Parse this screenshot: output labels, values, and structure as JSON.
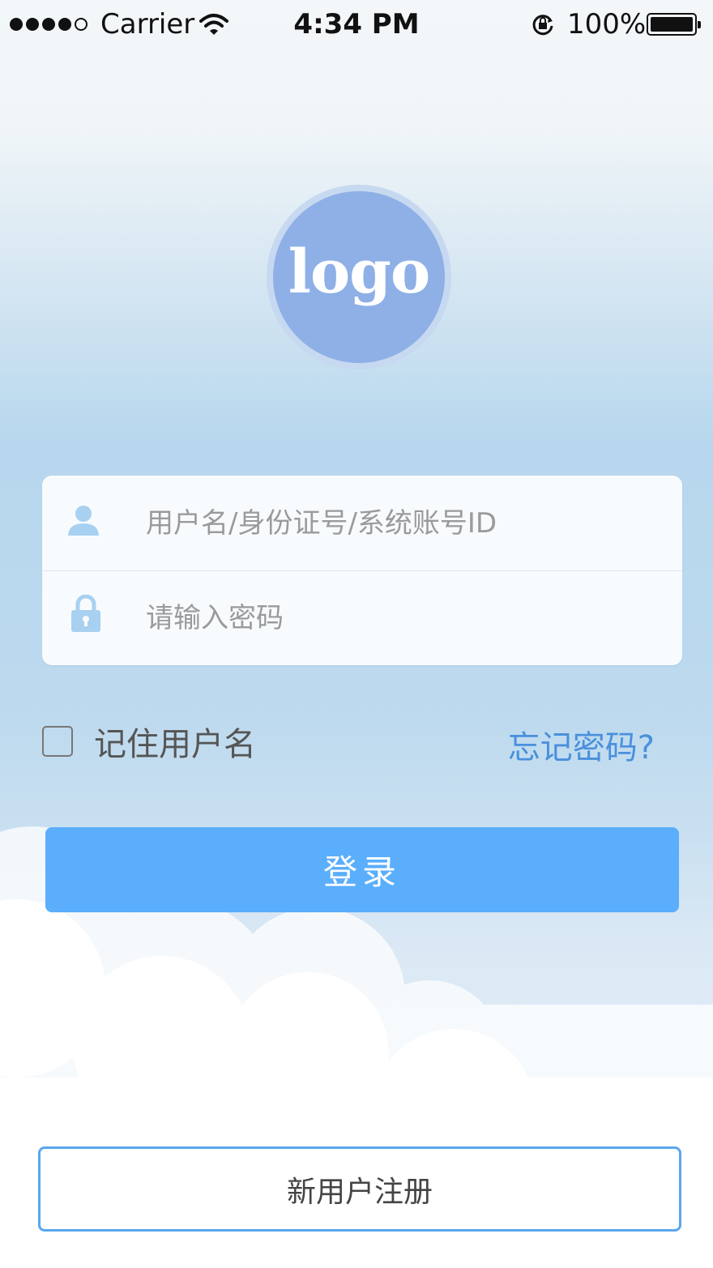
{
  "status_bar": {
    "carrier": "Carrier",
    "time": "4:34 PM",
    "battery_percent": "100%",
    "signal_bars_filled": 4,
    "signal_bars_total": 5
  },
  "logo": {
    "text": "logo"
  },
  "form": {
    "username_placeholder": "用户名/身份证号/系统账号ID",
    "username_value": "",
    "password_placeholder": "请输入密码",
    "password_value": ""
  },
  "options": {
    "remember_label": "记住用户名",
    "remember_checked": false,
    "forgot_label": "忘记密码?"
  },
  "actions": {
    "login_label": "登录",
    "register_label": "新用户注册"
  },
  "icons": {
    "user": "user-icon",
    "lock": "lock-icon",
    "wifi": "wifi-icon",
    "rotation_lock": "rotation-lock-icon",
    "battery": "battery-icon"
  },
  "colors": {
    "primary": "#5aaefc",
    "link": "#4a90dc",
    "logo_bg": "#8eb0e6",
    "icon": "#a8d0f0"
  }
}
